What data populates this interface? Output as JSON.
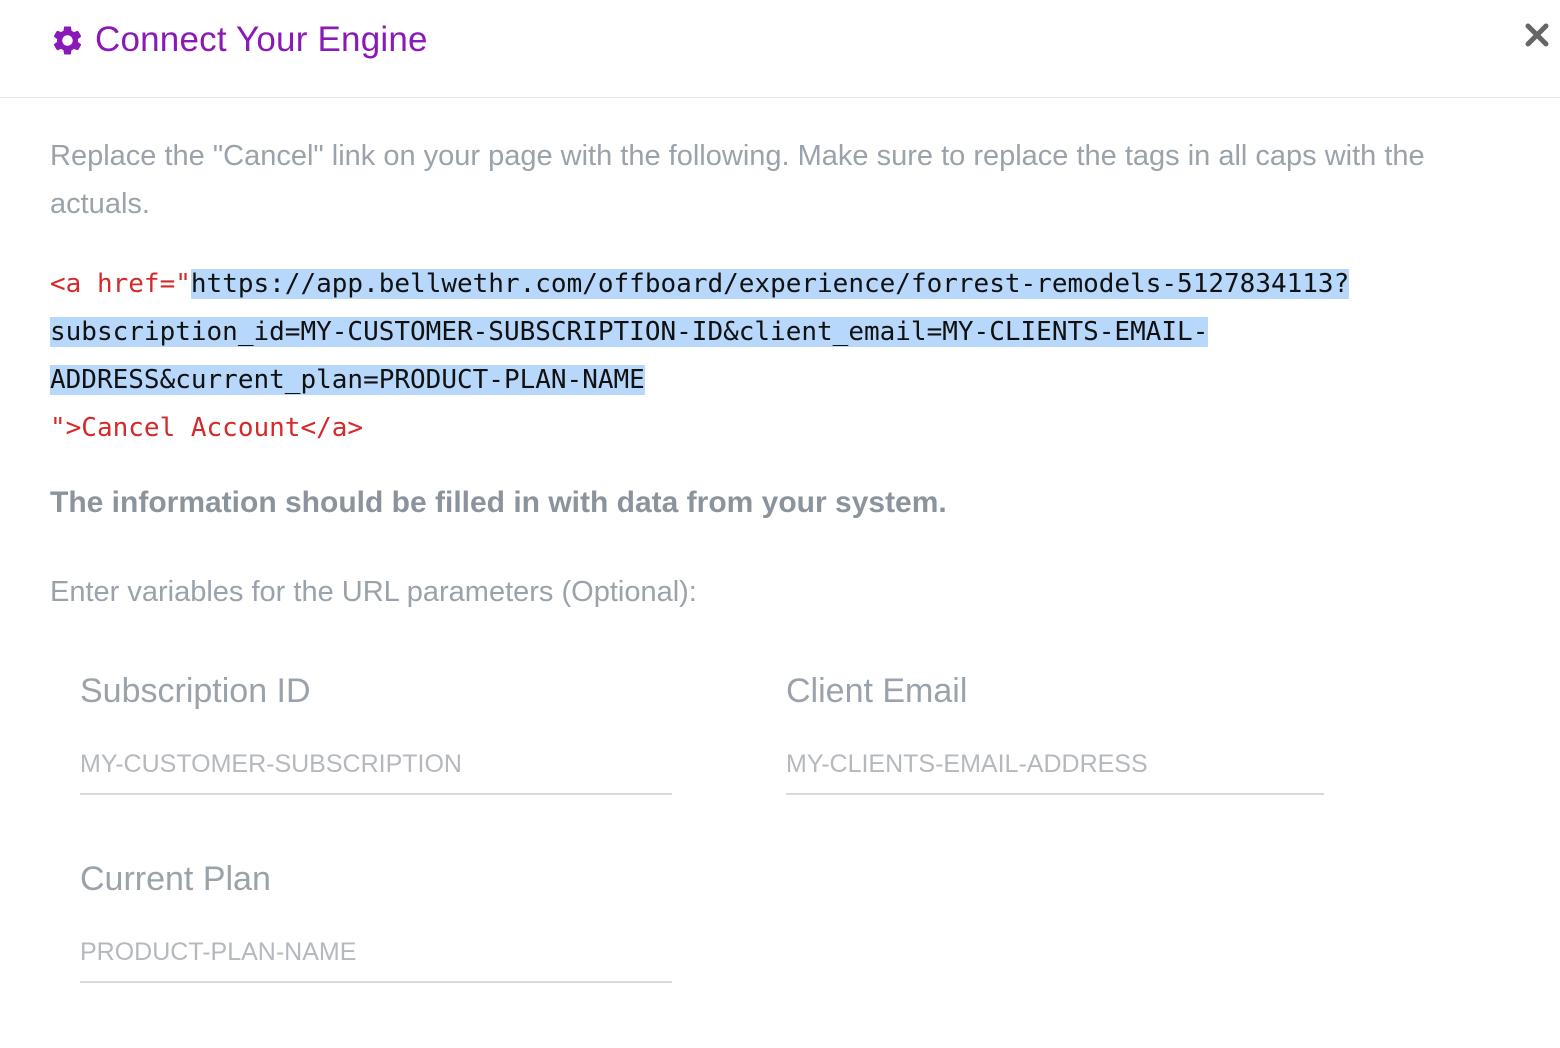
{
  "header": {
    "title": "Connect Your Engine",
    "title_color": "#8a1ab8",
    "icon": "gear-icon",
    "close_icon": "close-icon"
  },
  "intro_text": "Replace the \"Cancel\" link on your page with the following. Make sure to replace the tags in all caps with the actuals.",
  "code": {
    "open_tag": "<a href=\"",
    "url_line1": "https://app.bellwethr.com/offboard/experience/forrest-remodels-5127834113?",
    "url_line2": "subscription_id=MY-CUSTOMER-SUBSCRIPTION-ID&client_email=MY-CLIENTS-EMAIL-",
    "url_line3": "ADDRESS&current_plan=PRODUCT-PLAN-NAME",
    "close_tag": "\">Cancel Account</a>"
  },
  "info_bold": "The information should be filled in with data from your system.",
  "variables_label": "Enter variables for the URL parameters (Optional):",
  "fields": {
    "subscription_id": {
      "label": "Subscription ID",
      "placeholder": "MY-CUSTOMER-SUBSCRIPTION",
      "value": ""
    },
    "client_email": {
      "label": "Client Email",
      "placeholder": "MY-CLIENTS-EMAIL-ADDRESS",
      "value": ""
    },
    "current_plan": {
      "label": "Current Plan",
      "placeholder": "PRODUCT-PLAN-NAME",
      "value": ""
    }
  }
}
